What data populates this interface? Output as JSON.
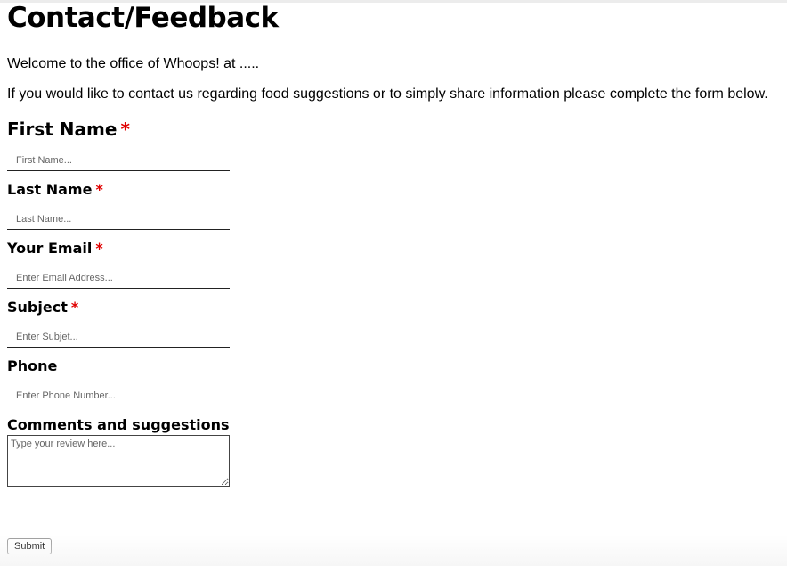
{
  "page": {
    "title": "Contact/Feedback",
    "intro_1": "Welcome to the office of Whoops! at .....",
    "intro_2": "If you would like to contact us regarding food suggestions or to simply share information please complete the form below."
  },
  "form": {
    "required_marker": "*",
    "first_name": {
      "label": "First Name",
      "placeholder": "First Name..."
    },
    "last_name": {
      "label": "Last Name",
      "placeholder": "Last Name..."
    },
    "email": {
      "label": "Your Email",
      "placeholder": "Enter Email Address..."
    },
    "subject": {
      "label": "Subject",
      "placeholder": "Enter Subjet..."
    },
    "phone": {
      "label": "Phone",
      "placeholder": "Enter Phone Number..."
    },
    "comments": {
      "label": "Comments and suggestions",
      "placeholder": "Type your review here..."
    },
    "submit_label": "Submit"
  },
  "colors": {
    "required": "#e00000",
    "text": "#000000",
    "underline": "#222222"
  }
}
